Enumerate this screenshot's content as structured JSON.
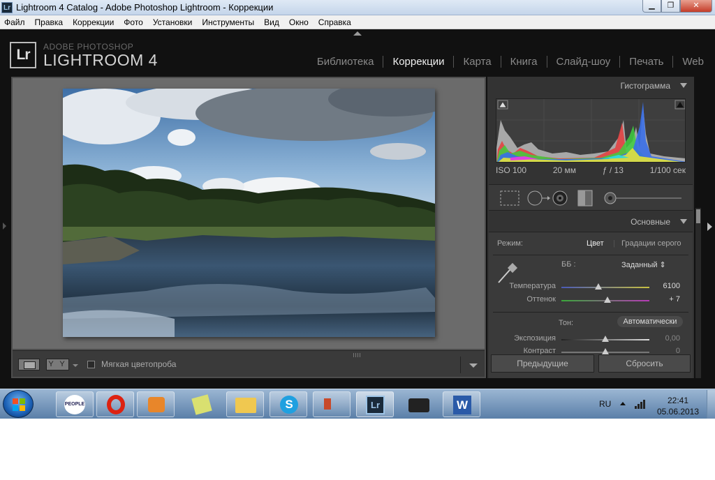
{
  "window": {
    "title": "Lightroom 4 Catalog - Adobe Photoshop Lightroom - Коррекции",
    "app_icon_text": "Lr",
    "minimize": "▁",
    "restore": "❐",
    "close": "✕"
  },
  "menu": [
    "Файл",
    "Правка",
    "Коррекции",
    "Фото",
    "Установки",
    "Инструменты",
    "Вид",
    "Окно",
    "Справка"
  ],
  "identity": {
    "badge": "Lr",
    "subtitle": "ADOBE PHOTOSHOP",
    "title": "LIGHTROOM 4"
  },
  "modules": [
    {
      "label": "Библиотека",
      "active": false
    },
    {
      "label": "Коррекции",
      "active": true
    },
    {
      "label": "Карта",
      "active": false
    },
    {
      "label": "Книга",
      "active": false
    },
    {
      "label": "Слайд-шоу",
      "active": false
    },
    {
      "label": "Печать",
      "active": false
    },
    {
      "label": "Web",
      "active": false
    }
  ],
  "toolbar": {
    "yy_label": "Y Y",
    "soft_proof_label": "Мягкая цветопроба",
    "soft_proof_checked": false
  },
  "histogram": {
    "header": "Гистограмма",
    "iso": "ISO 100",
    "focal": "20 мм",
    "aperture": "ƒ / 13",
    "shutter": "1/100 сек"
  },
  "basic": {
    "header": "Основные",
    "mode_label": "Режим:",
    "mode_color": "Цвет",
    "mode_bw": "Градации серого",
    "wb_label": "ББ :",
    "wb_value": "Заданный ⇕",
    "temp_label": "Температура",
    "temp_value": "6100",
    "temp_position": 0.42,
    "tint_label": "Оттенок",
    "tint_value": "+ 7",
    "tint_position": 0.52,
    "tone_label": "Тон:",
    "auto_label": "Автоматически",
    "exposure_label": "Экспозиция",
    "exposure_value": "0,00",
    "exposure_position": 0.5,
    "contrast_label": "Контраст",
    "contrast_value": "0",
    "contrast_position": 0.5
  },
  "buttons": {
    "previous": "Предыдущие",
    "reset": "Сбросить"
  },
  "taskbar": {
    "lang": "RU",
    "time": "22:41",
    "date": "05.06.2013",
    "people_label": "PEOPLE"
  },
  "colors": {
    "lr_dark": "#111111",
    "panel": "#333333",
    "taskbar": "#5a7fa8"
  }
}
